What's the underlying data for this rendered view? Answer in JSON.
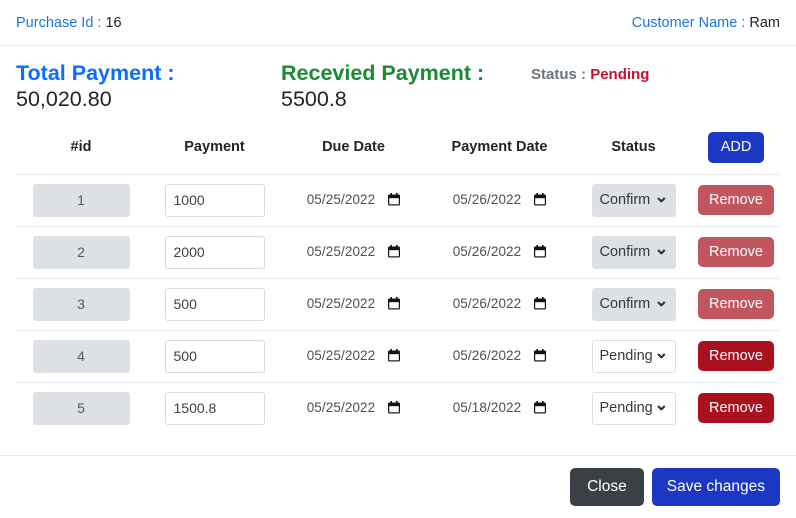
{
  "header": {
    "purchase_id_label": "Purchase Id :",
    "purchase_id_value": "16",
    "customer_label": "Customer Name :",
    "customer_value": "Ram"
  },
  "summary": {
    "total_label": "Total Payment :",
    "total_value": "50,020.80",
    "received_label": "Recevied Payment :",
    "received_value": "5500.8",
    "status_label": "Status :",
    "status_value": "Pending"
  },
  "table": {
    "columns": {
      "id": "#id",
      "payment": "Payment",
      "due_date": "Due Date",
      "payment_date": "Payment Date",
      "status": "Status",
      "action": "ADD"
    },
    "add_label": "ADD",
    "remove_label": "Remove",
    "status_options": [
      "Pending",
      "Confirm"
    ],
    "rows": [
      {
        "id": "1",
        "payment": "1000",
        "due_date": "05/25/2022",
        "payment_date": "05/26/2022",
        "status": "Confirm",
        "locked": true
      },
      {
        "id": "2",
        "payment": "2000",
        "due_date": "05/25/2022",
        "payment_date": "05/26/2022",
        "status": "Confirm",
        "locked": true
      },
      {
        "id": "3",
        "payment": "500",
        "due_date": "05/25/2022",
        "payment_date": "05/26/2022",
        "status": "Confirm",
        "locked": true
      },
      {
        "id": "4",
        "payment": "500",
        "due_date": "05/25/2022",
        "payment_date": "05/26/2022",
        "status": "Pending",
        "locked": false
      },
      {
        "id": "5",
        "payment": "1500.8",
        "due_date": "05/25/2022",
        "payment_date": "05/18/2022",
        "status": "Pending",
        "locked": false
      }
    ]
  },
  "footer": {
    "close_label": "Close",
    "save_label": "Save changes"
  },
  "colors": {
    "link_blue": "#1878dc",
    "total_blue": "#0d6efd",
    "received_green": "#1a8a33",
    "status_red": "#c8102e",
    "primary_blue": "#1b37c4",
    "remove_muted": "#c2565f",
    "remove_strong": "#ab1020",
    "close_dark": "#3a4046"
  }
}
